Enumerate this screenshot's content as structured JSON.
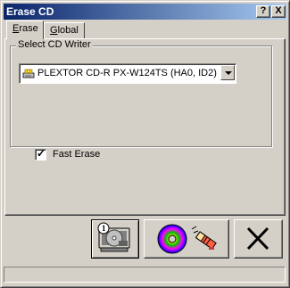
{
  "window": {
    "title": "Erase CD",
    "help_button": "?",
    "close_button": "X"
  },
  "tabs": [
    {
      "label_underlined": "E",
      "label_rest": "rase"
    },
    {
      "label_underlined": "G",
      "label_rest": "lobal"
    }
  ],
  "group": {
    "legend": "Select CD Writer",
    "cd_writer": "PLEXTOR CD-R   PX-W124TS (HA0, ID2)",
    "fast_erase_label": "Fast Erase",
    "fast_erase_checked": true
  },
  "buttons": [
    {
      "name": "erase-disc-button",
      "icon": "disc-info-icon"
    },
    {
      "name": "erase-start-button",
      "icon": "disc-eraser-icon"
    },
    {
      "name": "cancel-button",
      "icon": "close-x-icon"
    }
  ],
  "status": {
    "text": ""
  }
}
